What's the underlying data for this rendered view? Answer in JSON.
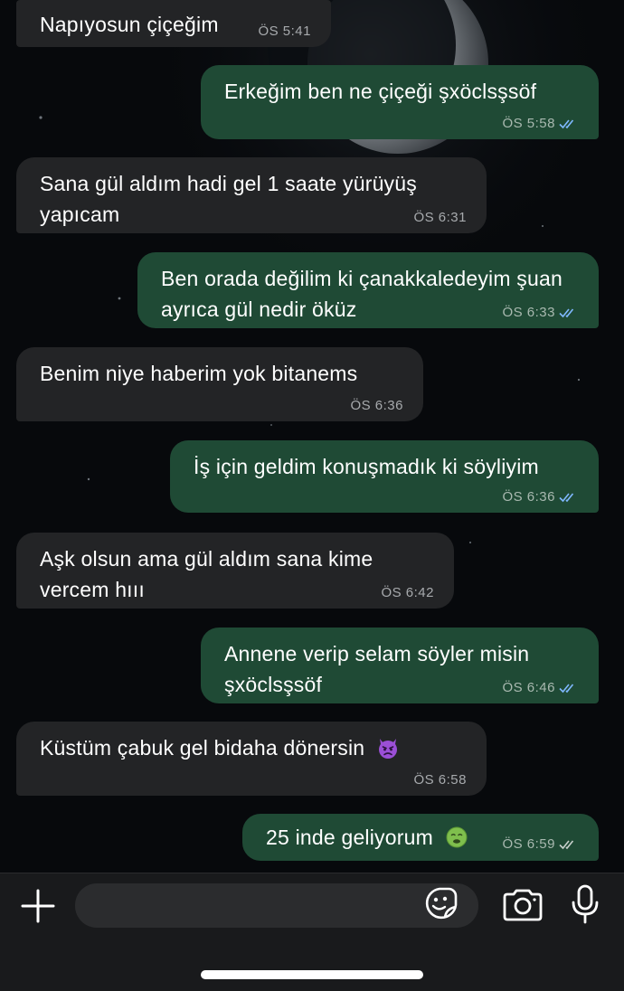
{
  "messages": [
    {
      "dir": "in",
      "text": "Napıyosun çiçeğim",
      "time": "ÖS 5:41",
      "ticks": "",
      "emoji": ""
    },
    {
      "dir": "out",
      "text": "Erkeğim ben ne çiçeği şxöclsşsöf",
      "time": "ÖS 5:58",
      "ticks": "read",
      "emoji": ""
    },
    {
      "dir": "in",
      "text": "Sana gül aldım hadi gel 1 saate yürüyüş yapıcam",
      "time": "ÖS 6:31",
      "ticks": "",
      "emoji": ""
    },
    {
      "dir": "out",
      "text": "Ben orada değilim ki çanakkaledeyim şuan ayrıca gül nedir öküz",
      "time": "ÖS 6:33",
      "ticks": "read",
      "emoji": ""
    },
    {
      "dir": "in",
      "text": "Benim niye haberim yok bitanems",
      "time": "ÖS 6:36",
      "ticks": "",
      "emoji": ""
    },
    {
      "dir": "out",
      "text": "İş için geldim konuşmadık ki söyliyim",
      "time": "ÖS 6:36",
      "ticks": "read",
      "emoji": ""
    },
    {
      "dir": "in",
      "text": "Aşk olsun ama gül aldım sana kime vercem hııı",
      "time": "ÖS 6:42",
      "ticks": "",
      "emoji": ""
    },
    {
      "dir": "out",
      "text": "Annene verip selam söyler misin şxöclsşsöf",
      "time": "ÖS 6:46",
      "ticks": "read",
      "emoji": ""
    },
    {
      "dir": "in",
      "text": "Küstüm çabuk gel bidaha dönersin",
      "time": "ÖS 6:58",
      "ticks": "",
      "emoji": "angry-devil"
    },
    {
      "dir": "out",
      "text": "25 inde geliyorum",
      "time": "ÖS 6:59",
      "ticks": "delivered",
      "emoji": "nauseated-face"
    }
  ],
  "composer": {
    "placeholder": "",
    "icons": {
      "plus": "plus-icon",
      "sticker": "sticker-icon",
      "camera": "camera-icon",
      "mic": "microphone-icon"
    }
  },
  "colors": {
    "incoming_bubble": "#232426",
    "outgoing_bubble": "#1f4a35",
    "read_ticks": "#7fb8ff",
    "delivered_ticks": "#c7cfcb"
  }
}
